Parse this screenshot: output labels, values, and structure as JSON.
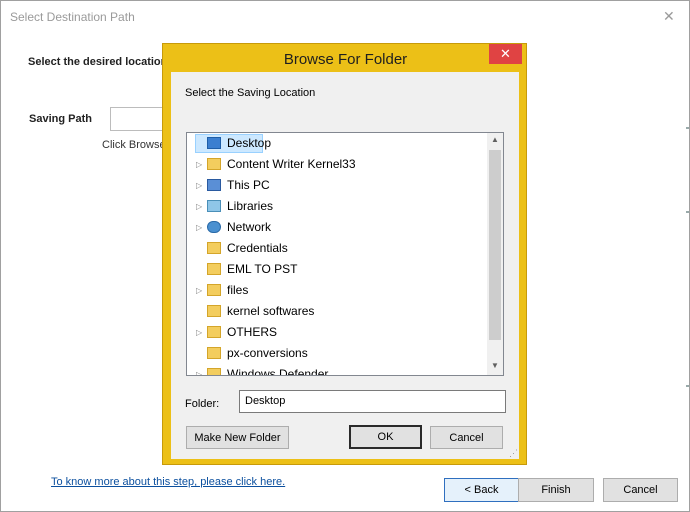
{
  "outer": {
    "title": "Select Destination Path",
    "close_glyph": "✕",
    "instruction": "Select the desired location",
    "saving_label": "Saving Path",
    "click_browse": "Click Browse",
    "help_link": "To know more about this step, please click here.",
    "back_label": "< Back",
    "finish_label": "Finish",
    "cancel_label": "Cancel"
  },
  "browse": {
    "title": "Browse For Folder",
    "close_glyph": "✕",
    "instruction": "Select the Saving Location",
    "tree": [
      {
        "label": "Desktop",
        "icon": "desktop-icon",
        "arrow": "",
        "selected": true
      },
      {
        "label": "Content Writer Kernel33",
        "icon": "user-folder-icon",
        "arrow": "▷"
      },
      {
        "label": "This PC",
        "icon": "computer-icon",
        "arrow": "▷"
      },
      {
        "label": "Libraries",
        "icon": "libraries-icon",
        "arrow": "▷"
      },
      {
        "label": "Network",
        "icon": "network-icon",
        "arrow": "▷"
      },
      {
        "label": "Credentials",
        "icon": "folder-icon",
        "arrow": ""
      },
      {
        "label": "EML TO PST",
        "icon": "folder-icon",
        "arrow": ""
      },
      {
        "label": "files",
        "icon": "folder-icon",
        "arrow": "▷"
      },
      {
        "label": "kernel softwares",
        "icon": "folder-icon",
        "arrow": ""
      },
      {
        "label": "OTHERS",
        "icon": "folder-icon",
        "arrow": "▷"
      },
      {
        "label": "px-conversions",
        "icon": "folder-icon",
        "arrow": ""
      },
      {
        "label": "Windows Defender",
        "icon": "folder-icon",
        "arrow": "▷"
      }
    ],
    "folder_label": "Folder:",
    "folder_value": "Desktop",
    "make_folder_label": "Make New Folder",
    "ok_label": "OK",
    "cancel_label": "Cancel"
  },
  "colors": {
    "dialog_frame": "#ecc017",
    "close_red": "#e04343",
    "selection": "#cce8ff",
    "link": "#0b4f9e"
  }
}
